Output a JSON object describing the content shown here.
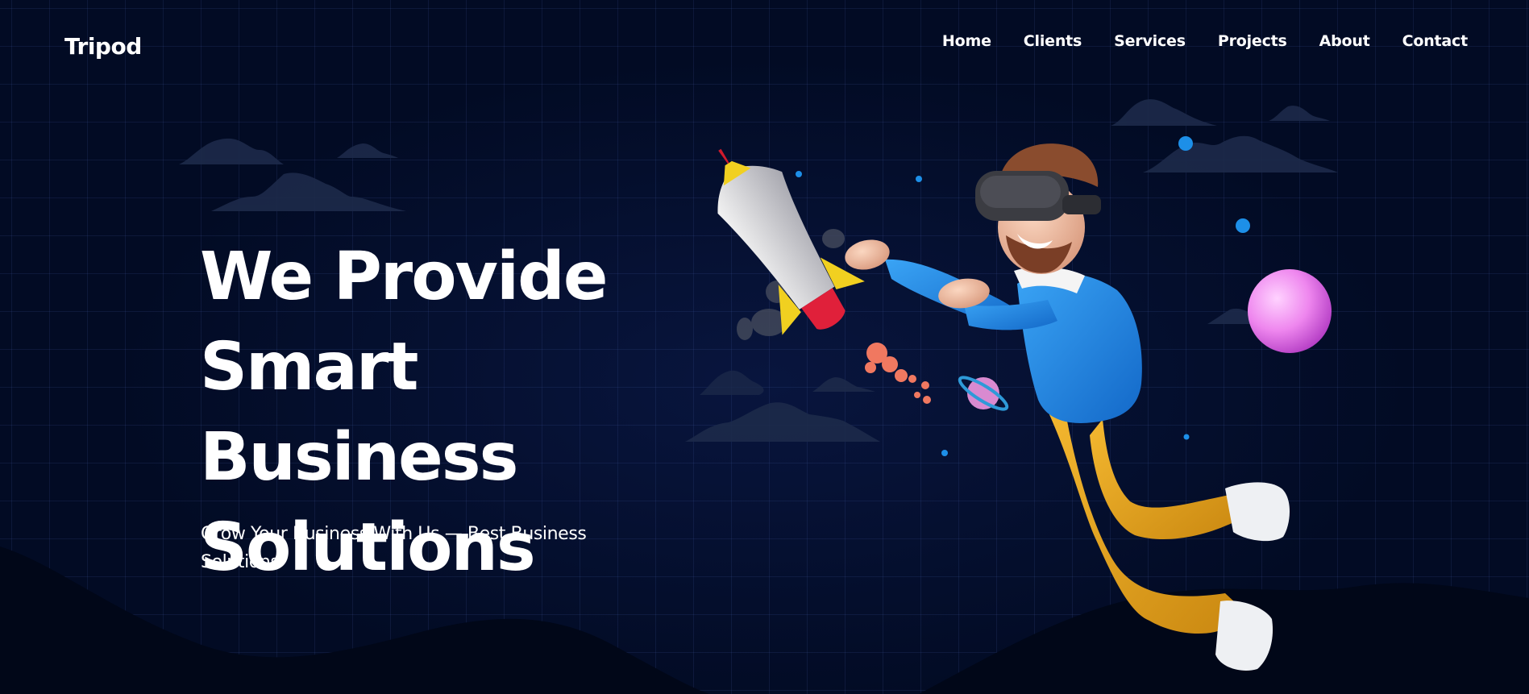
{
  "brand": {
    "logo": "Tripod"
  },
  "nav": {
    "items": [
      {
        "label": "Home"
      },
      {
        "label": "Clients"
      },
      {
        "label": "Services"
      },
      {
        "label": "Projects"
      },
      {
        "label": "About"
      },
      {
        "label": "Contact"
      }
    ]
  },
  "hero": {
    "title_lines": [
      "We Provide",
      "Smart Business",
      "Solutions"
    ],
    "subtitle": "Grow Your Business With Us — Best Business Solutions",
    "illustration": "3d-man-vr-headset-chasing-rocket"
  },
  "colors": {
    "background": "#020b24",
    "text": "#ffffff",
    "shirt": "#1a86e0",
    "pants": "#e6a520",
    "rocket_body": "#d9d9d9",
    "rocket_accent": "#f1d020",
    "rocket_nose_base": "#e0203a",
    "orb": "#ee86ee",
    "dots": "#1d8fe8"
  },
  "icons": {
    "decor": [
      "cloud-shape",
      "orb-sphere",
      "planet-ring",
      "star-dot"
    ]
  }
}
